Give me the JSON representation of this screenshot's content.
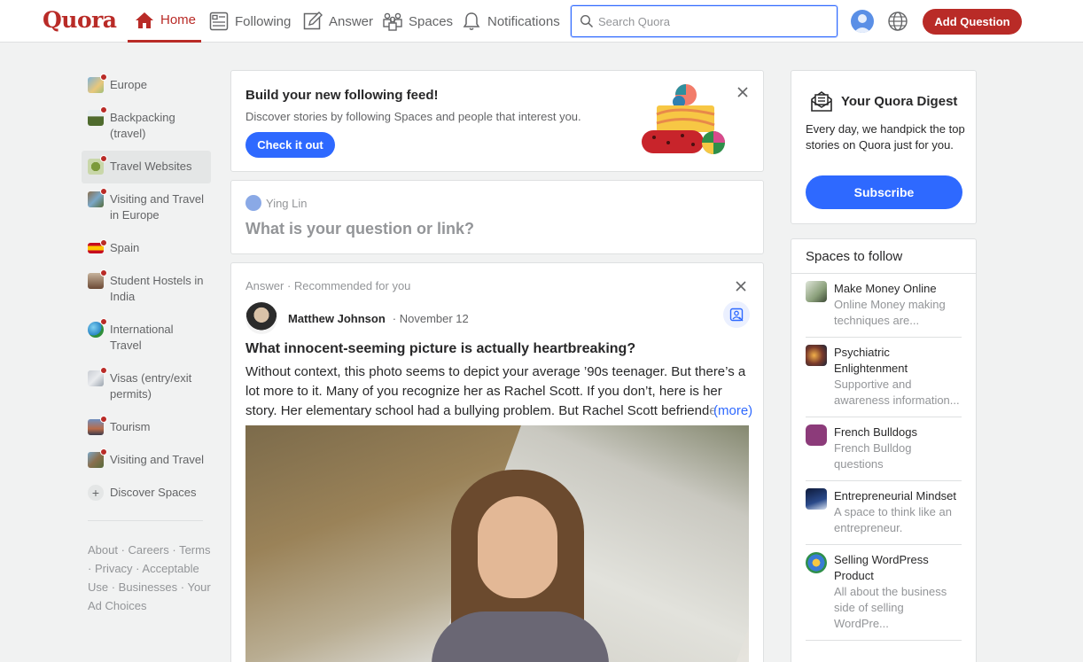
{
  "header": {
    "logo": "Quora",
    "nav": {
      "home": "Home",
      "following": "Following",
      "answer": "Answer",
      "spaces": "Spaces",
      "notifications": "Notifications"
    },
    "search_placeholder": "Search Quora",
    "add_question": "Add Question",
    "accent_color": "#b92b27"
  },
  "sidebar": {
    "spaces": [
      {
        "label": "Europe",
        "icon": "europe-space-icon"
      },
      {
        "label": "Backpacking (travel)",
        "icon": "backpacking-space-icon"
      },
      {
        "label": "Travel Websites",
        "icon": "travel-websites-space-icon"
      },
      {
        "label": "Visiting and Travel in Europe",
        "icon": "visiting-europe-space-icon"
      },
      {
        "label": "Spain",
        "icon": "spain-flag-icon"
      },
      {
        "label": "Student Hostels in India",
        "icon": "hostels-space-icon"
      },
      {
        "label": "International Travel",
        "icon": "globe-space-icon"
      },
      {
        "label": "Visas (entry/exit permits)",
        "icon": "visas-space-icon"
      },
      {
        "label": "Tourism",
        "icon": "tourism-space-icon"
      },
      {
        "label": "Visiting and Travel",
        "icon": "visiting-travel-space-icon"
      }
    ],
    "discover": "Discover Spaces",
    "footer": "About · Careers · Terms · Privacy · Acceptable Use · Businesses · Your Ad Choices"
  },
  "follow_card": {
    "title": "Build your new following feed!",
    "subtitle": "Discover stories by following Spaces and people that interest you.",
    "button": "Check it out"
  },
  "ask_card": {
    "user": "Ying Lin",
    "prompt": "What is your question or link?"
  },
  "answer_card": {
    "meta": "Answer · Recommended for you",
    "author": "Matthew Johnson",
    "date": "· November 12",
    "question": "What innocent-seeming picture is actually heartbreaking?",
    "body": "Without context, this photo seems to depict your average ’90s teenager. But there’s a lot more to it. Many of you recognize her as Rachel Scott. If you don’t, here is her story. Her elementary school had a bullying problem. But Rachel Scott befriended",
    "more": "(more)"
  },
  "digest": {
    "title": "Your Quora Digest",
    "text": "Every day, we handpick the top stories on Quora just for you.",
    "button": "Subscribe",
    "button_color": "#2e69ff"
  },
  "spaces_to_follow": {
    "title": "Spaces to follow",
    "items": [
      {
        "name": "Make Money Online",
        "desc": "Online Money making techniques are...",
        "icon": "money-space-icon"
      },
      {
        "name": "Psychiatric Enlightenment",
        "desc": "Supportive and awareness information...",
        "icon": "psychiatric-space-icon"
      },
      {
        "name": "French Bulldogs",
        "desc": "French Bulldog questions",
        "icon": "bulldog-space-icon"
      },
      {
        "name": "Entrepreneurial Mindset",
        "desc": "A space to think like an entrepreneur.",
        "icon": "entrepreneur-space-icon"
      },
      {
        "name": "Selling WordPress Product",
        "desc": "All about the business side of selling WordPre...",
        "icon": "wordpress-space-icon"
      }
    ]
  }
}
